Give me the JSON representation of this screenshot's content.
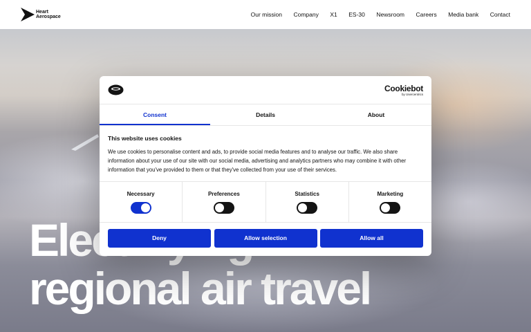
{
  "brand": {
    "name_line1": "Heart",
    "name_line2": "Aerospace"
  },
  "nav": {
    "items": [
      {
        "label": "Our mission"
      },
      {
        "label": "Company"
      },
      {
        "label": "X1"
      },
      {
        "label": "ES-30"
      },
      {
        "label": "Newsroom"
      },
      {
        "label": "Careers"
      },
      {
        "label": "Media bank"
      },
      {
        "label": "Contact"
      }
    ]
  },
  "hero": {
    "headline_line1": "Electrifying",
    "headline_line2": "regional air travel"
  },
  "cookie_dialog": {
    "provider_name": "Cookiebot",
    "provider_by": "by Usercentrics",
    "tabs": [
      {
        "label": "Consent",
        "active": true
      },
      {
        "label": "Details",
        "active": false
      },
      {
        "label": "About",
        "active": false
      }
    ],
    "heading": "This website uses cookies",
    "body": "We use cookies to personalise content and ads, to provide social media features and to analyse our traffic. We also share information about your use of our site with our social media, advertising and analytics partners who may combine it with other information that you've provided to them or that they've collected from your use of their services.",
    "toggles": [
      {
        "label": "Necessary",
        "on": true
      },
      {
        "label": "Preferences",
        "on": false
      },
      {
        "label": "Statistics",
        "on": false
      },
      {
        "label": "Marketing",
        "on": false
      }
    ],
    "buttons": {
      "deny": "Deny",
      "allow_selection": "Allow selection",
      "allow_all": "Allow all"
    }
  },
  "colors": {
    "accent": "#1032cf",
    "text": "#141414"
  }
}
